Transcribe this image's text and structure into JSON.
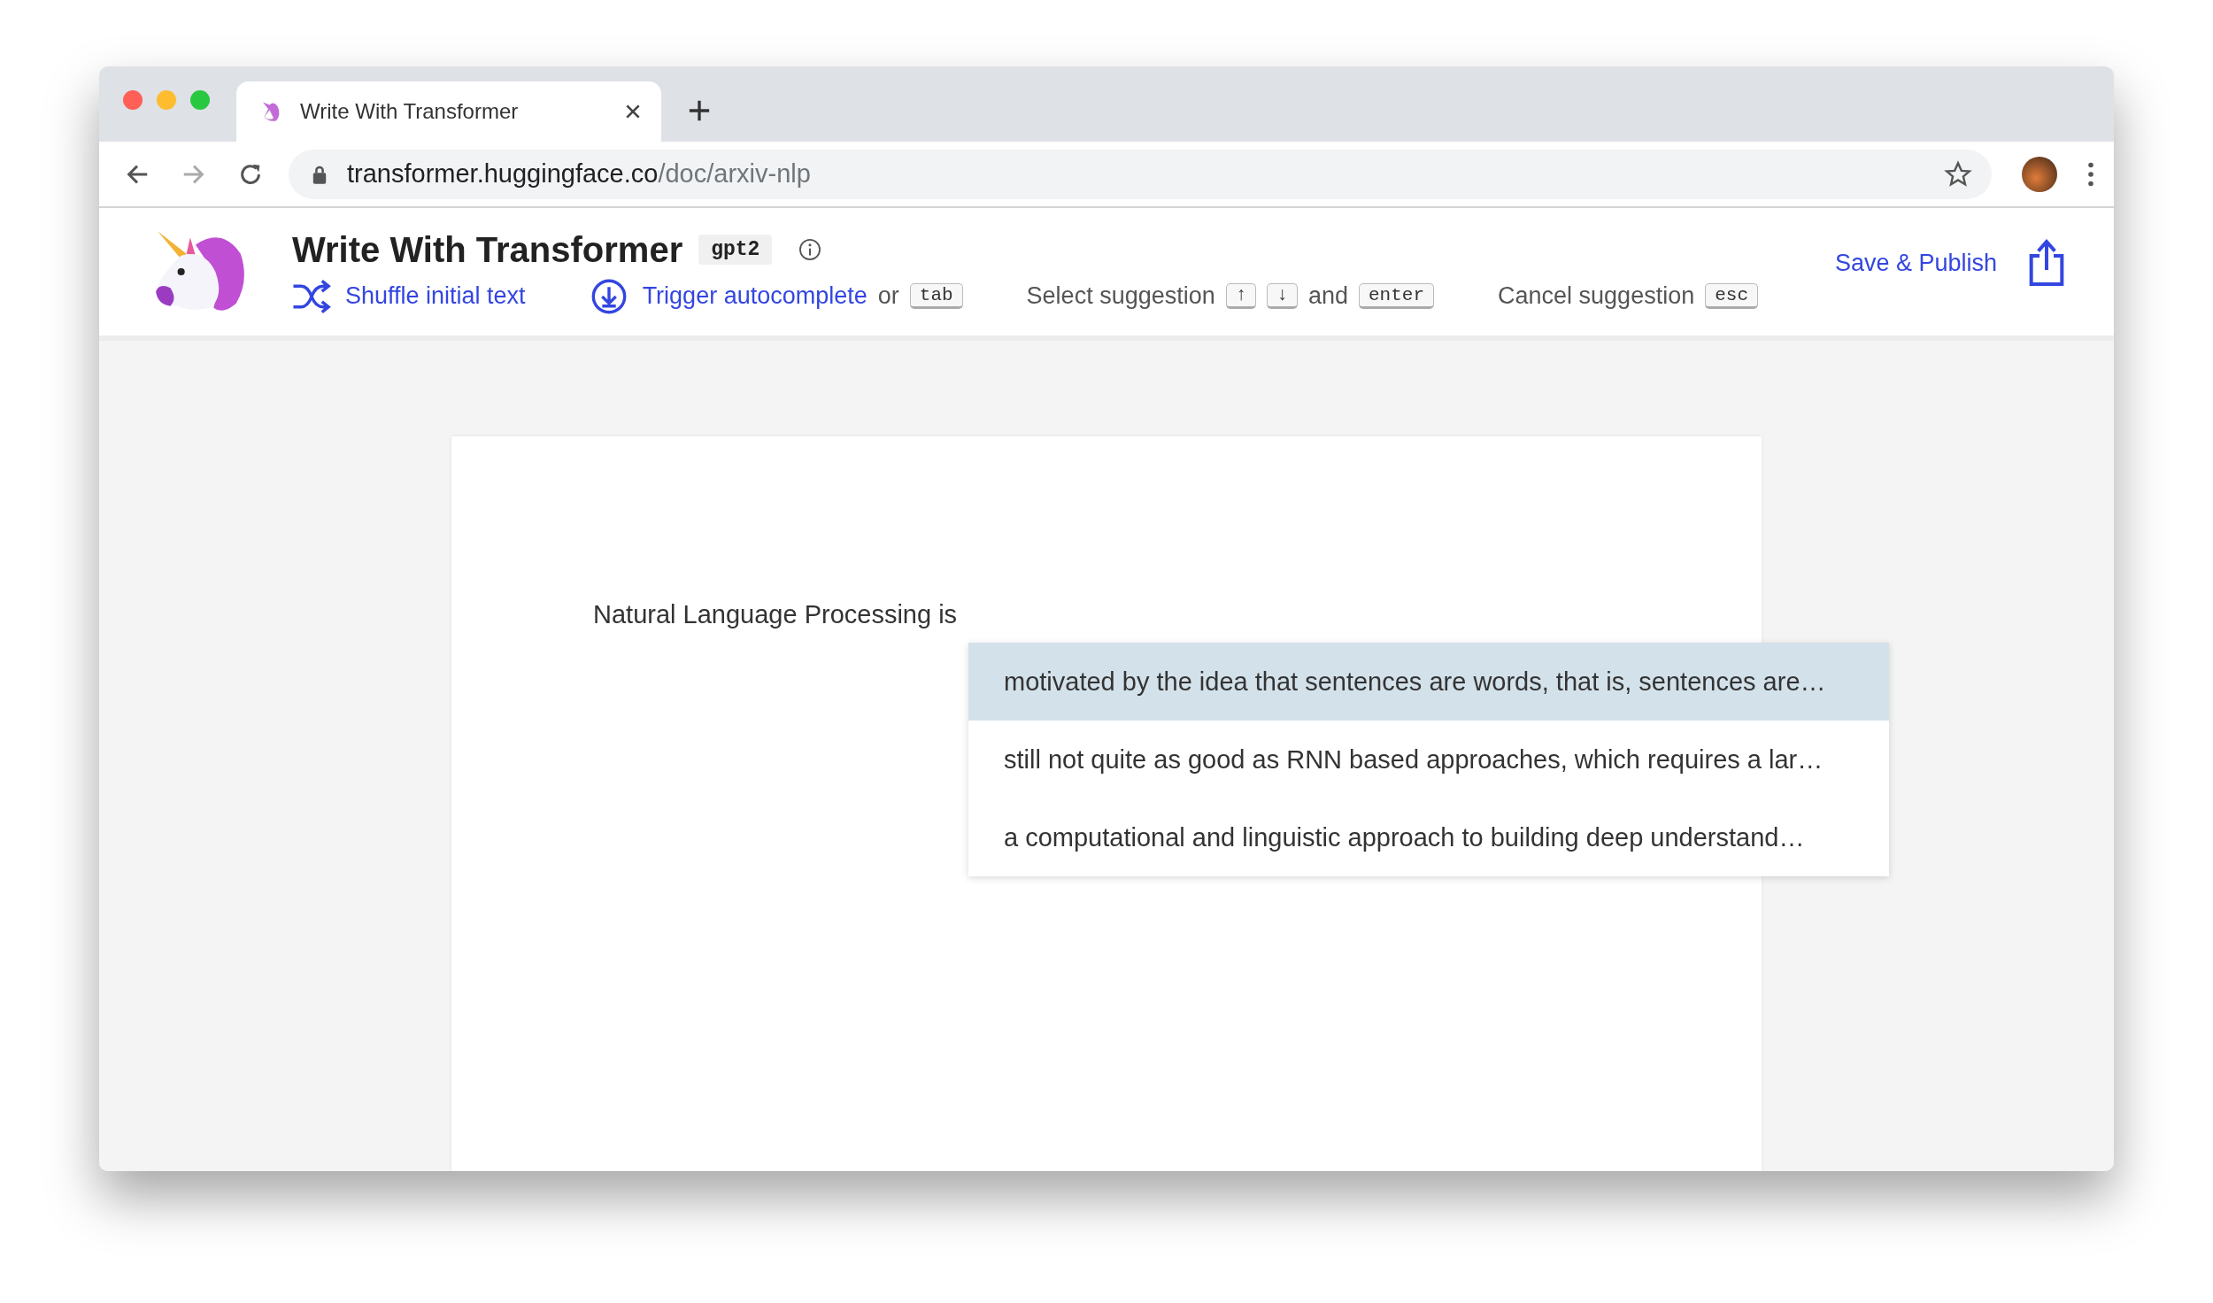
{
  "browser": {
    "tab": {
      "title": "Write With Transformer",
      "selected": true
    },
    "address": {
      "domain": "transformer.huggingface.co",
      "path": "/doc/arxiv-nlp"
    }
  },
  "header": {
    "title": "Write With Transformer",
    "model_badge": "gpt2",
    "toolbar": [
      {
        "parts": [
          {
            "kind": "shuffle",
            "text": "Shuffle initial text"
          }
        ]
      },
      {
        "parts": [
          {
            "kind": "trigger",
            "text": "Trigger autocomplete"
          },
          {
            "kind": "text",
            "text": "or"
          },
          {
            "kind": "key",
            "text": "tab"
          }
        ]
      },
      {
        "parts": [
          {
            "kind": "text",
            "text": "Select suggestion"
          },
          {
            "kind": "key",
            "text": "↑"
          },
          {
            "kind": "key",
            "text": "↓"
          },
          {
            "kind": "text",
            "text": "and"
          },
          {
            "kind": "key",
            "text": "enter"
          }
        ]
      },
      {
        "parts": [
          {
            "kind": "text",
            "text": "Cancel suggestion"
          },
          {
            "kind": "key",
            "text": "esc"
          }
        ]
      }
    ],
    "publish": "Save & Publish"
  },
  "document": {
    "text": "Natural Language Processing is",
    "suggestions": [
      {
        "text": "motivated by the idea that sentences are words, that is, sentences are…",
        "selected": true
      },
      {
        "text": "still not quite as good as RNN based approaches, which requires a lar…",
        "selected": false
      },
      {
        "text": "a computational and linguistic approach to building deep understand…",
        "selected": false
      }
    ]
  }
}
